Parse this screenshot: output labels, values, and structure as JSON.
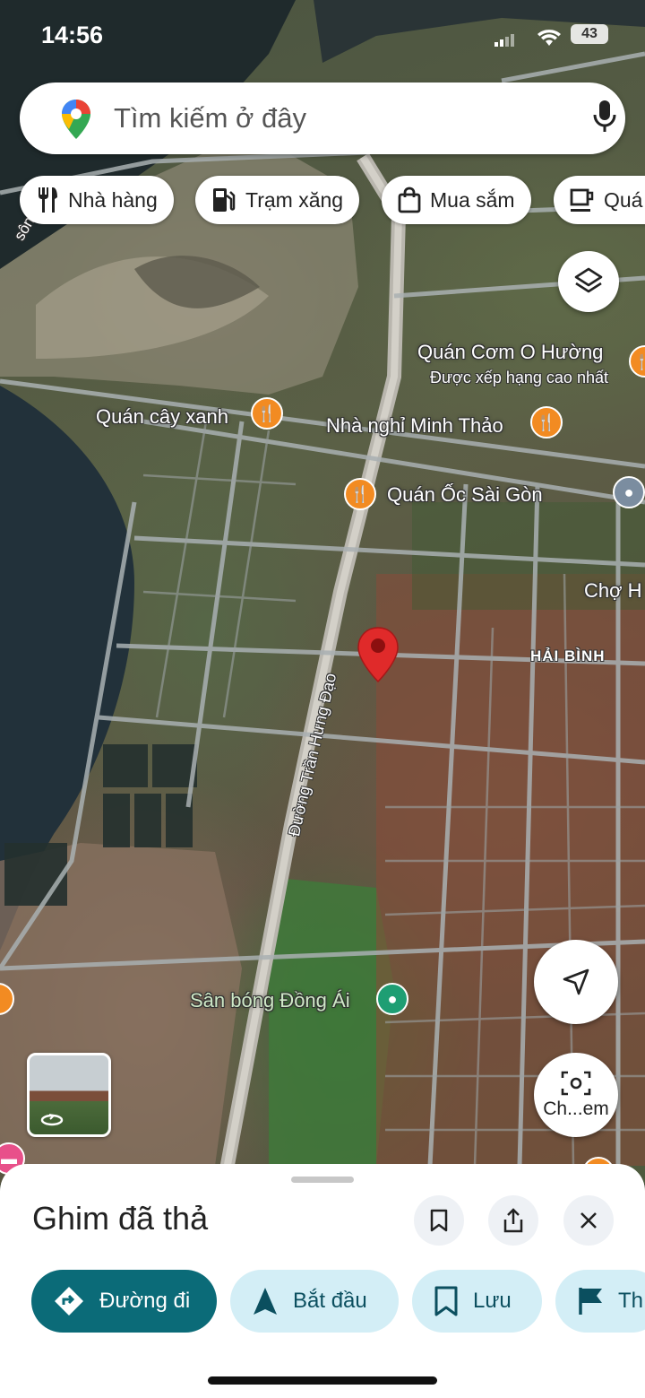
{
  "status_bar": {
    "time": "14:56",
    "battery": "43"
  },
  "search": {
    "placeholder": "Tìm kiếm ở đây"
  },
  "chips": [
    {
      "label": "Nhà hàng",
      "icon": "utensils-icon"
    },
    {
      "label": "Trạm xăng",
      "icon": "gas-station-icon"
    },
    {
      "label": "Mua sắm",
      "icon": "shopping-bag-icon"
    },
    {
      "label": "Quá",
      "icon": "coffee-cup-icon"
    }
  ],
  "map": {
    "river_label": "sông  h Bạ",
    "places": [
      {
        "name": "Quán Cơm O Hường",
        "subtitle": "Được xếp hạng cao nhất",
        "type": "restaurant"
      },
      {
        "name": "Quán cây xanh",
        "type": "restaurant"
      },
      {
        "name": "Nhà nghỉ Minh Thảo",
        "type": "restaurant"
      },
      {
        "name": "Quán Ốc Sài Gòn",
        "type": "restaurant"
      },
      {
        "name": "Chợ H",
        "type": "market"
      },
      {
        "name": "Sân bóng Đồng Ái",
        "type": "park"
      }
    ],
    "area": "HẢI BÌNH",
    "road": "Đường Trần Hưng Đạo"
  },
  "controls": {
    "camera_label": "Ch...em"
  },
  "sheet": {
    "title": "Ghim đã thả",
    "actions": [
      {
        "label": "Đường đi"
      },
      {
        "label": "Bắt đầu"
      },
      {
        "label": "Lưu"
      },
      {
        "label": "Th"
      }
    ]
  },
  "colors": {
    "accent": "#0b6b78",
    "chip_bg": "#d3eef6",
    "pin_red": "#e02a2a",
    "food_pin": "#f28b22"
  }
}
